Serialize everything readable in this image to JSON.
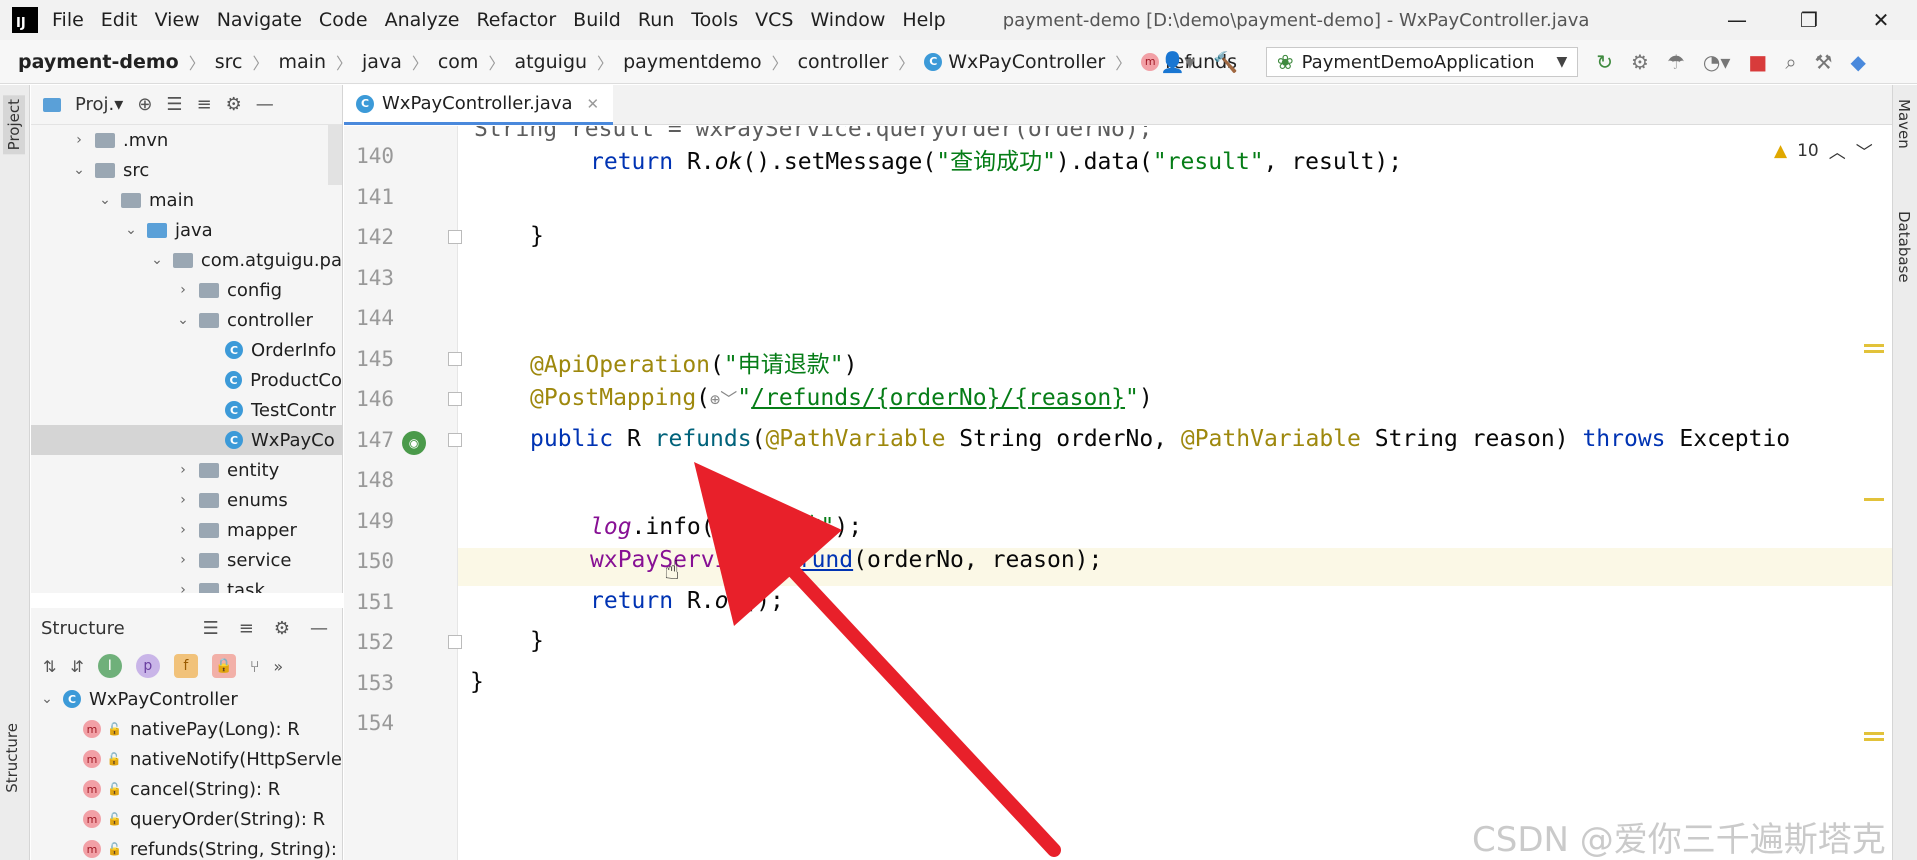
{
  "window": {
    "title": "payment-demo [D:\\demo\\payment-demo] - WxPayController.java",
    "app_logo": "IJ",
    "minimize": "—",
    "maximize": "❐",
    "close": "✕"
  },
  "menu": [
    {
      "label": "File"
    },
    {
      "label": "Edit"
    },
    {
      "label": "View"
    },
    {
      "label": "Navigate"
    },
    {
      "label": "Code"
    },
    {
      "label": "Analyze"
    },
    {
      "label": "Refactor"
    },
    {
      "label": "Build"
    },
    {
      "label": "Run"
    },
    {
      "label": "Tools"
    },
    {
      "label": "VCS"
    },
    {
      "label": "Window"
    },
    {
      "label": "Help"
    }
  ],
  "breadcrumb": [
    "payment-demo",
    "src",
    "main",
    "java",
    "com",
    "atguigu",
    "paymentdemo",
    "controller",
    "WxPayController",
    "refunds"
  ],
  "run_config": "PaymentDemoApplication",
  "project_panel": {
    "title": "Proj.▾",
    "tree": [
      {
        "label": ".mvn"
      },
      {
        "label": "src"
      },
      {
        "label": "main"
      },
      {
        "label": "java"
      },
      {
        "label": "com.atguigu.pa"
      },
      {
        "label": "config"
      },
      {
        "label": "controller"
      },
      {
        "label": "OrderInfo"
      },
      {
        "label": "ProductCo"
      },
      {
        "label": "TestContr"
      },
      {
        "label": "WxPayCo"
      },
      {
        "label": "entity"
      },
      {
        "label": "enums"
      },
      {
        "label": "mapper"
      },
      {
        "label": "service"
      },
      {
        "label": "task"
      }
    ]
  },
  "structure_panel": {
    "title": "Structure",
    "root": "WxPayController",
    "methods": [
      "nativePay(Long): R",
      "nativeNotify(HttpServle",
      "cancel(String): R",
      "queryOrder(String): R",
      "refunds(String, String):"
    ]
  },
  "left_stripe": {
    "project_tab": "Project",
    "structure_tab": "Structure"
  },
  "right_stripe": {
    "maven_tab": "Maven",
    "database_tab": "Database"
  },
  "editor": {
    "tab_label": "WxPayController.java",
    "warnings": "10",
    "partial_top_line": "String result = wxPayService.queryOrder(orderNo);",
    "line_numbers": [
      "140",
      "141",
      "142",
      "143",
      "144",
      "145",
      "146",
      "147",
      "148",
      "149",
      "150",
      "151",
      "152",
      "153",
      "154"
    ],
    "code": {
      "l140_a": "return",
      "l140_b": " R.",
      "l140_c": "ok",
      "l140_d": "().setMessage(",
      "l140_e": "\"查询成功\"",
      "l140_f": ").data(",
      "l140_g": "\"result\"",
      "l140_h": ", result);",
      "l142": "}",
      "l145_a": "@ApiOperation",
      "l145_b": "(",
      "l145_c": "\"申请退款\"",
      "l145_d": ")",
      "l146_a": "@PostMapping",
      "l146_b": "(",
      "l146_c": "\"",
      "l146_d": "/refunds/{orderNo}/{reason}",
      "l146_e": "\"",
      "l146_f": ")",
      "l147_a": "public",
      "l147_b": " R ",
      "l147_c": "refunds",
      "l147_d": "(",
      "l147_e": "@PathVariable",
      "l147_f": " String orderNo, ",
      "l147_g": "@PathVariable",
      "l147_h": " String reason) ",
      "l147_i": "throws",
      "l147_j": " Exceptio",
      "l149_a": "log",
      "l149_b": ".info(",
      "l149_c": "\"申请退款\"",
      "l149_d": ");",
      "l150_a": "wxPayService",
      "l150_b": ".",
      "l150_c": "refund",
      "l150_d": "(orderNo, reason);",
      "l151_a": "return",
      "l151_b": " R.",
      "l151_c": "ok",
      "l151_d": "();",
      "l152": "}",
      "l153": "}"
    }
  },
  "watermark": "CSDN @爱你三千遍斯塔克",
  "colors": {
    "keyword": "#0033b3",
    "string": "#067d17",
    "annotation": "#9e880d",
    "arrow": "#e8202a",
    "selection": "#d5d5d5"
  }
}
